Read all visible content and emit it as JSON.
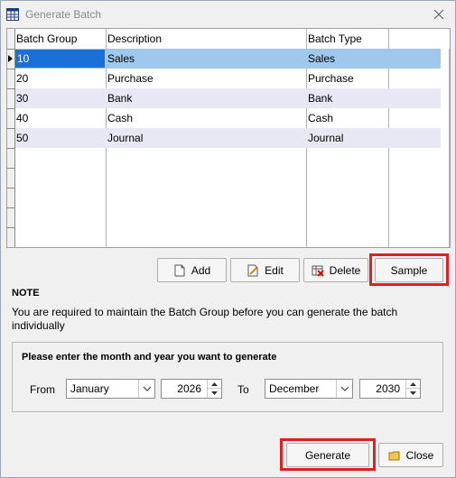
{
  "window": {
    "title": "Generate Batch"
  },
  "grid": {
    "headers": [
      "Batch Group",
      "Description",
      "Batch Type"
    ],
    "rows": [
      {
        "group": "10",
        "description": "Sales",
        "type": "Sales"
      },
      {
        "group": "20",
        "description": "Purchase",
        "type": "Purchase"
      },
      {
        "group": "30",
        "description": "Bank",
        "type": "Bank"
      },
      {
        "group": "40",
        "description": "Cash",
        "type": "Cash"
      },
      {
        "group": "50",
        "description": "Journal",
        "type": "Journal"
      }
    ]
  },
  "actions": {
    "add": "Add",
    "edit": "Edit",
    "delete": "Delete",
    "sample": "Sample"
  },
  "note": {
    "title": "NOTE",
    "body": "You are required to maintain the Batch Group before you can generate the batch individually"
  },
  "period": {
    "title": "Please enter the month and year you want to generate",
    "from_label": "From",
    "from_month": "January",
    "from_year": "2026",
    "to_label": "To",
    "to_month": "December",
    "to_year": "2030"
  },
  "footer": {
    "generate": "Generate",
    "close": "Close"
  },
  "colors": {
    "highlight_frame": "#e02020",
    "selected_row": "#9fc8ec",
    "edit_cell": "#1c6fd6"
  }
}
